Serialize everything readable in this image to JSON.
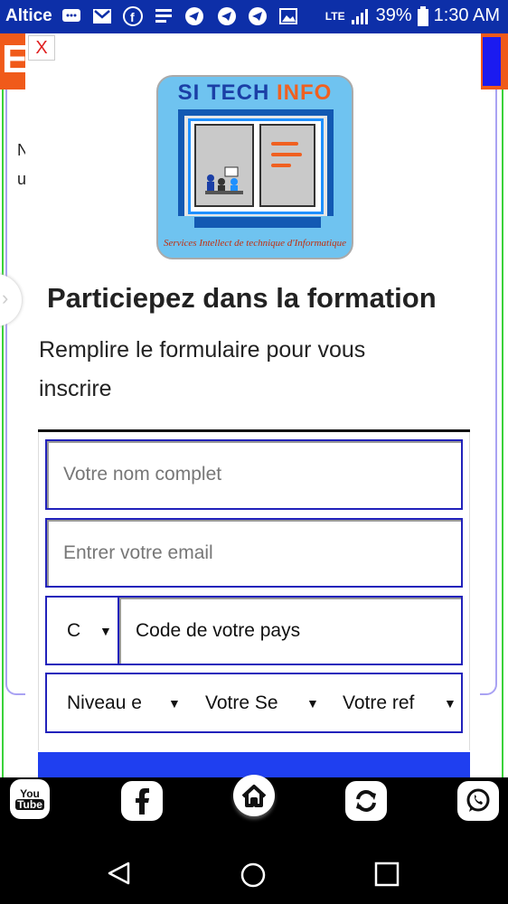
{
  "status_bar": {
    "carrier": "Altice",
    "network": "LTE",
    "battery": "39%",
    "time": "1:30 AM",
    "icons": [
      "messages-icon",
      "gmail-icon",
      "facebook-icon",
      "news-icon",
      "telegram-icon",
      "telegram-icon",
      "telegram-icon",
      "gallery-icon"
    ]
  },
  "background_page": {
    "logo_letter": "E",
    "edge_letters": [
      "N",
      "u"
    ]
  },
  "modal": {
    "close_label": "X",
    "logo": {
      "title_part1": "SI TECH",
      "title_part2": "INFO",
      "caption": "Services Intellect de technique d'Informatique"
    },
    "heading": "Particiepez dans la formation",
    "subtitle": "Remplire le formulaire pour vous inscrire",
    "form": {
      "name_placeholder": "Votre nom complet",
      "email_placeholder": "Entrer votre email",
      "country_select": "C",
      "phone_placeholder": "Code de votre pays",
      "level_select": "Niveau e",
      "session_select": "Votre Se",
      "ref_select": "Votre ref"
    }
  },
  "bottom_nav": {
    "youtube_label_1": "You",
    "youtube_label_2": "Tube",
    "items": [
      "youtube-icon",
      "facebook-icon",
      "home-icon",
      "refresh-icon",
      "whatsapp-icon"
    ]
  },
  "colors": {
    "status_bar": "#0d2fa8",
    "accent_orange": "#f05a1a",
    "field_border": "#2222bb",
    "submit_button": "#1f3ff0",
    "close_x": "#e02020"
  }
}
